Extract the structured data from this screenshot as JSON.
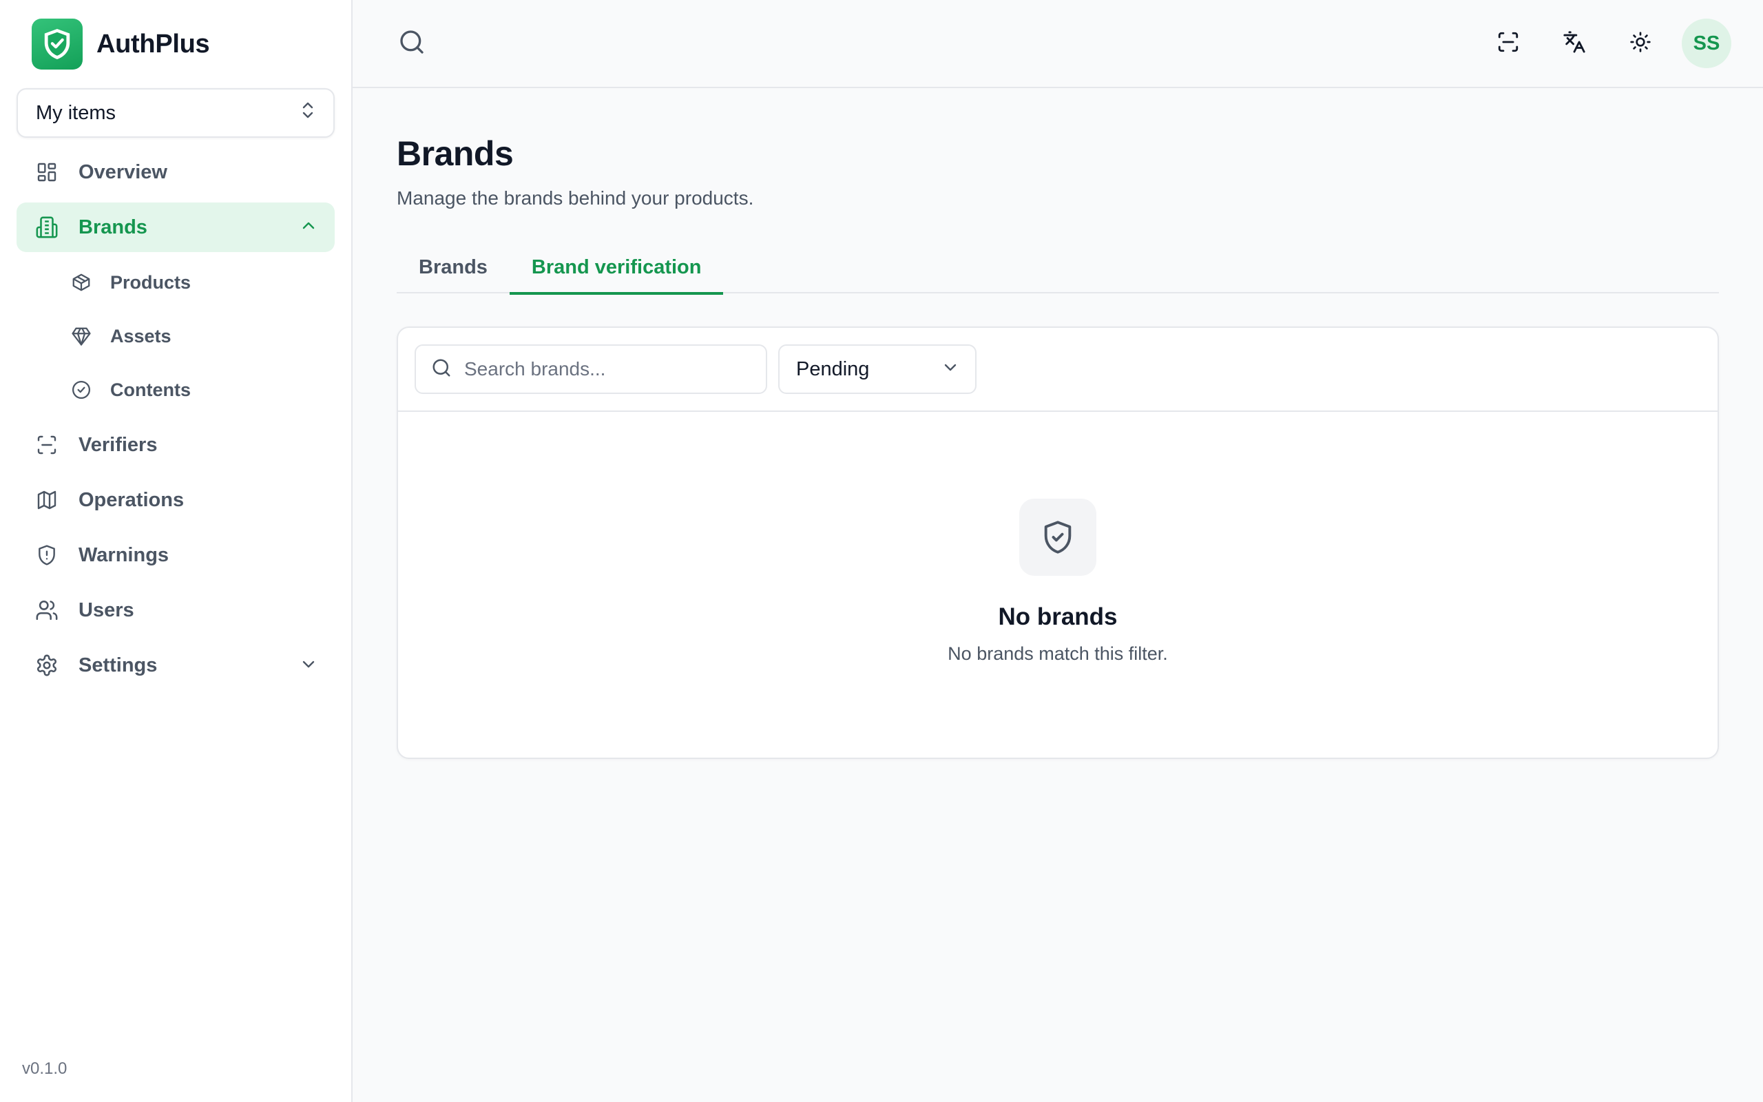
{
  "app": {
    "name": "AuthPlus",
    "version": "v0.1.0",
    "accent_color": "#15964f"
  },
  "sidebar": {
    "workspace": "My items",
    "items": [
      {
        "label": "Overview",
        "icon": "grid-icon"
      },
      {
        "label": "Brands",
        "icon": "building-icon",
        "active": true,
        "expanded": true,
        "children": [
          {
            "label": "Products",
            "icon": "package-icon"
          },
          {
            "label": "Assets",
            "icon": "gem-icon"
          },
          {
            "label": "Contents",
            "icon": "badge-check-icon"
          }
        ]
      },
      {
        "label": "Verifiers",
        "icon": "scan-icon"
      },
      {
        "label": "Operations",
        "icon": "map-icon"
      },
      {
        "label": "Warnings",
        "icon": "shield-alert-icon"
      },
      {
        "label": "Users",
        "icon": "users-icon"
      },
      {
        "label": "Settings",
        "icon": "gear-icon",
        "collapsible": true
      }
    ]
  },
  "topbar": {
    "avatar_initials": "SS",
    "actions": [
      "scan-icon",
      "translate-icon",
      "sun-icon"
    ]
  },
  "page": {
    "title": "Brands",
    "subtitle": "Manage the brands behind your products.",
    "tabs": [
      {
        "label": "Brands",
        "active": false
      },
      {
        "label": "Brand verification",
        "active": true
      }
    ],
    "filters": {
      "search_placeholder": "Search brands...",
      "status_value": "Pending"
    },
    "empty_state": {
      "title": "No brands",
      "message": "No brands match this filter."
    }
  }
}
